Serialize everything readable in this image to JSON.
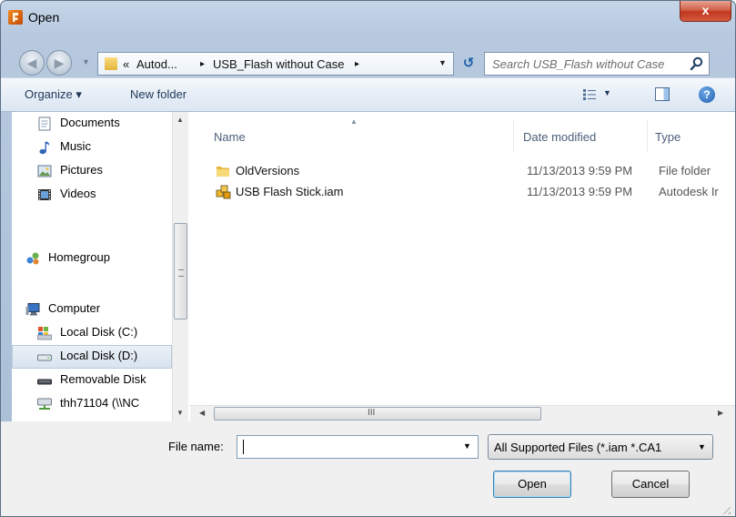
{
  "window": {
    "title": "Open",
    "close_label": "x"
  },
  "address_bar": {
    "overflow_chevron": "«",
    "crumbs": [
      "Autod...",
      "USB_Flash without Case"
    ],
    "separator": "▸"
  },
  "search": {
    "placeholder": "Search USB_Flash without Case"
  },
  "toolbar": {
    "organize_label": "Organize ▾",
    "new_folder_label": "New folder"
  },
  "nav_pane": {
    "items": [
      {
        "label": "Documents",
        "icon": "documents-icon"
      },
      {
        "label": "Music",
        "icon": "music-icon"
      },
      {
        "label": "Pictures",
        "icon": "pictures-icon"
      },
      {
        "label": "Videos",
        "icon": "videos-icon"
      },
      {
        "label": "Homegroup",
        "icon": "homegroup-icon"
      },
      {
        "label": "Computer",
        "icon": "computer-icon"
      },
      {
        "label": "Local Disk (C:)",
        "icon": "local-disk-icon"
      },
      {
        "label": "Local Disk (D:)",
        "icon": "local-disk-icon",
        "selected": true
      },
      {
        "label": "Removable Disk",
        "icon": "removable-disk-icon"
      },
      {
        "label": "thh71104 (\\\\NC",
        "icon": "network-drive-icon"
      }
    ]
  },
  "file_list": {
    "columns": [
      "Name",
      "Date modified",
      "Type"
    ],
    "rows": [
      {
        "name": "OldVersions",
        "date": "11/13/2013 9:59 PM",
        "type": "File folder",
        "icon": "folder-icon"
      },
      {
        "name": "USB Flash Stick.iam",
        "date": "11/13/2013 9:59 PM",
        "type": "Autodesk Ir",
        "icon": "assembly-file-icon"
      }
    ],
    "scrollbar_label": "III"
  },
  "footer": {
    "file_name_label": "File name:",
    "file_name_value": "",
    "filter_value": "All Supported Files (*.iam *.CA1",
    "open_label": "Open",
    "cancel_label": "Cancel"
  }
}
